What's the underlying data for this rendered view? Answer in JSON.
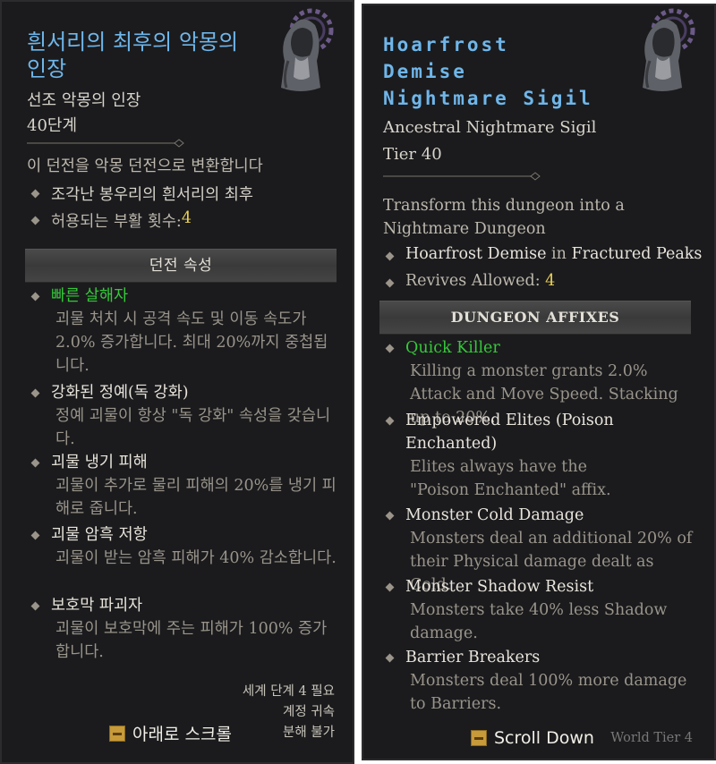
{
  "korean": {
    "title": "흰서리의 최후의 악몽의 인장",
    "item_type": "선조 악몽의 인장",
    "tier": "40단계",
    "description": "이 던전을 악몽 던전으로 변환합니다",
    "dungeon": "조각난 봉우리의 흰서리의 최후",
    "revives_label": "허용되는 부활 횟수: ",
    "revives_value": "4",
    "affixes_header": "던전 속성",
    "affixes": [
      {
        "name": "빠른 살해자",
        "desc": "괴물 처치 시 공격 속도 및 이동 속도가 2.0% 증가합니다. 최대 20%까지 중첩됩니다."
      },
      {
        "name": "강화된 정예(독 강화)",
        "desc": "정예 괴물이 항상 \"독 강화\" 속성을 갖습니다."
      },
      {
        "name": "괴물 냉기 피해",
        "desc": "괴물이 추가로 물리 피해의 20%를 냉기 피해로 줍니다."
      },
      {
        "name": "괴물 암흑 저항",
        "desc": "괴물이 받는 암흑 피해가 40% 감소합니다."
      },
      {
        "name": "보호막 파괴자",
        "desc": "괴물이 보호막에 주는 피해가 100% 증가합니다."
      }
    ],
    "footer": [
      "세계 단계 4 필요",
      "계정 귀속",
      "분해 불가"
    ],
    "scroll_label": "아래로 스크롤"
  },
  "english": {
    "title": "Hoarfrost Demise Nightmare Sigil",
    "item_type": "Ancestral Nightmare Sigil",
    "tier": "Tier 40",
    "description": "Transform this dungeon into a Nightmare Dungeon",
    "dungeon_name": "Hoarfrost Demise",
    "dungeon_in": " in ",
    "dungeon_region": "Fractured Peaks",
    "revives_label": "Revives Allowed: ",
    "revives_value": "4",
    "affixes_header": "DUNGEON AFFIXES",
    "affixes": [
      {
        "name": "Quick Killer",
        "desc": "Killing a monster grants 2.0% Attack and Move Speed. Stacking up to 20%."
      },
      {
        "name": "Empowered Elites (Poison Enchanted)",
        "desc": "Elites always have the \"Poison Enchanted\" affix."
      },
      {
        "name": "Monster Cold Damage",
        "desc": "Monsters deal an additional 20% of their Physical damage dealt as Cold."
      },
      {
        "name": "Monster Shadow Resist",
        "desc": "Monsters take 40% less Shadow damage."
      },
      {
        "name": "Barrier Breakers",
        "desc": "Monsters deal 100% more damage to Barriers."
      }
    ],
    "footer": [
      "World Tier 4"
    ],
    "scroll_label": "Scroll Down"
  },
  "colors": {
    "title": "#6fb6ea",
    "highlight_number": "#e7cf58",
    "quick_killer": "#35c93a",
    "panel_bg": "#1b1b1d"
  },
  "icons": [
    "nightmare-sigil-emblem-icon",
    "diamond-bullet-icon",
    "scroll-key-icon"
  ]
}
